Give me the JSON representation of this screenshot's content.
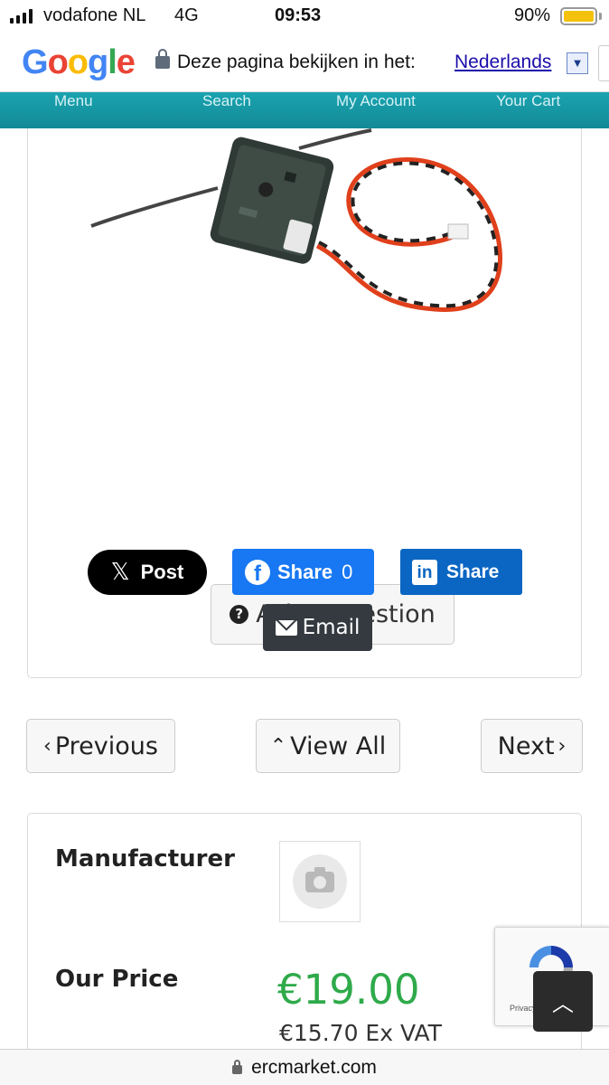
{
  "status_bar": {
    "carrier": "vodafone NL",
    "network": "4G",
    "time": "09:53",
    "battery": "90%",
    "battery_level": 0.9
  },
  "translate_bar": {
    "logo": [
      "G",
      "o",
      "o",
      "g",
      "l",
      "e"
    ],
    "prompt": "Deze pagina bekijken in het:",
    "language": "Nederlands",
    "dropdown_glyph": "▼"
  },
  "site_nav": {
    "items": [
      "Menu",
      "Search",
      "My Account",
      "Your Cart"
    ]
  },
  "product": {
    "image_icon": "rc-receiver-photo",
    "ask_question": "Ask a question",
    "ask_icon": "question-circle-icon",
    "ask_icon_glyph": "?"
  },
  "share": {
    "x_logo": "𝕏",
    "x_label": "Post",
    "facebook_logo": "f",
    "facebook_label": "Share",
    "facebook_count": "0",
    "linkedin_logo": "in",
    "linkedin_label": "Share",
    "email_label": "Email"
  },
  "pager": {
    "prev_chevron": "‹",
    "prev": "Previous",
    "all_chevron": "⌃",
    "all": "View All",
    "next": "Next",
    "next_chevron": "›"
  },
  "info": {
    "manufacturer_label": "Manufacturer",
    "manufacturer_logo": "camera-placeholder-icon",
    "price_label": "Our Price",
    "price": "€19.00",
    "price_ex_vat": "€15.70 Ex VAT"
  },
  "recaptcha": {
    "text": "Privacy - Terms"
  },
  "back_to_top": {
    "glyph": "︿"
  },
  "url_bar": {
    "domain": "ercmarket.com"
  },
  "colors": {
    "nav_teal": "#1aa3b0",
    "price_green": "#2eaa4a",
    "facebook_blue": "#1877f2",
    "linkedin_blue": "#0a66c2",
    "email_dark": "#343a40"
  }
}
